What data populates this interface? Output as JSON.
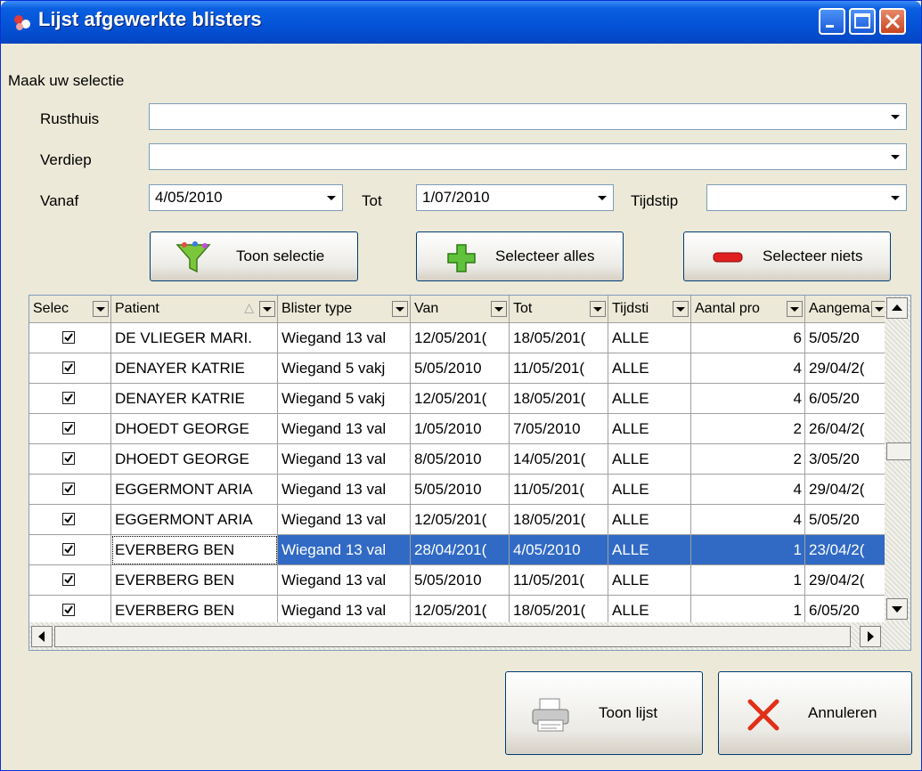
{
  "window": {
    "title": "Lijst afgewerkte blisters"
  },
  "selection": {
    "heading": "Maak uw selectie",
    "rusthuis_label": "Rusthuis",
    "rusthuis_value": "",
    "verdiep_label": "Verdiep",
    "verdiep_value": "",
    "vanaf_label": "Vanaf",
    "vanaf_value": "4/05/2010",
    "tot_label": "Tot",
    "tot_value": "1/07/2010",
    "tijdstip_label": "Tijdstip",
    "tijdstip_value": ""
  },
  "actions": {
    "toon_selectie": "Toon selectie",
    "selecteer_alles": "Selecteer alles",
    "selecteer_niets": "Selecteer niets"
  },
  "grid": {
    "columns": [
      "Selec",
      "Patient",
      "Blister type",
      "Van",
      "Tot",
      "Tijdsti",
      "Aantal pro",
      "Aangema"
    ],
    "sorted_column_indicator": "△",
    "rows": [
      {
        "checked": true,
        "patient": "DE VLIEGER MARI.",
        "blister_type": "Wiegand 13 val",
        "van": "12/05/201(",
        "tot": "18/05/201(",
        "tijdstip": "ALLE",
        "aantal": "6",
        "aangemaakt": "5/05/20"
      },
      {
        "checked": true,
        "patient": "DENAYER KATRIE",
        "blister_type": "Wiegand 5 vakj",
        "van": "5/05/2010",
        "tot": "11/05/201(",
        "tijdstip": "ALLE",
        "aantal": "4",
        "aangemaakt": "29/04/2("
      },
      {
        "checked": true,
        "patient": "DENAYER KATRIE",
        "blister_type": "Wiegand 5 vakj",
        "van": "12/05/201(",
        "tot": "18/05/201(",
        "tijdstip": "ALLE",
        "aantal": "4",
        "aangemaakt": "6/05/20"
      },
      {
        "checked": true,
        "patient": "DHOEDT GEORGE",
        "blister_type": "Wiegand 13 val",
        "van": "1/05/2010",
        "tot": "7/05/2010",
        "tijdstip": "ALLE",
        "aantal": "2",
        "aangemaakt": "26/04/2("
      },
      {
        "checked": true,
        "patient": "DHOEDT GEORGE",
        "blister_type": "Wiegand 13 val",
        "van": "8/05/2010",
        "tot": "14/05/201(",
        "tijdstip": "ALLE",
        "aantal": "2",
        "aangemaakt": "3/05/20"
      },
      {
        "checked": true,
        "patient": "EGGERMONT ARIA",
        "blister_type": "Wiegand 13 val",
        "van": "5/05/2010",
        "tot": "11/05/201(",
        "tijdstip": "ALLE",
        "aantal": "4",
        "aangemaakt": "29/04/2("
      },
      {
        "checked": true,
        "patient": "EGGERMONT ARIA",
        "blister_type": "Wiegand 13 val",
        "van": "12/05/201(",
        "tot": "18/05/201(",
        "tijdstip": "ALLE",
        "aantal": "4",
        "aangemaakt": "5/05/20"
      },
      {
        "checked": true,
        "patient": "EVERBERG BEN",
        "blister_type": "Wiegand 13 val",
        "van": "28/04/201(",
        "tot": "4/05/2010",
        "tijdstip": "ALLE",
        "aantal": "1",
        "aangemaakt": "23/04/2(",
        "selected": true
      },
      {
        "checked": true,
        "patient": "EVERBERG BEN",
        "blister_type": "Wiegand 13 val",
        "van": "5/05/2010",
        "tot": "11/05/201(",
        "tijdstip": "ALLE",
        "aantal": "1",
        "aangemaakt": "29/04/2("
      },
      {
        "checked": true,
        "patient": "EVERBERG BEN",
        "blister_type": "Wiegand 13 val",
        "van": "12/05/201(",
        "tot": "18/05/201(",
        "tijdstip": "ALLE",
        "aantal": "1",
        "aangemaakt": "6/05/20"
      }
    ]
  },
  "footer": {
    "toon_lijst": "Toon lijst",
    "annuleren": "Annuleren"
  },
  "colors": {
    "titlebar": "#0452D6",
    "selection": "#316AC5",
    "background": "#ECE9D8"
  }
}
